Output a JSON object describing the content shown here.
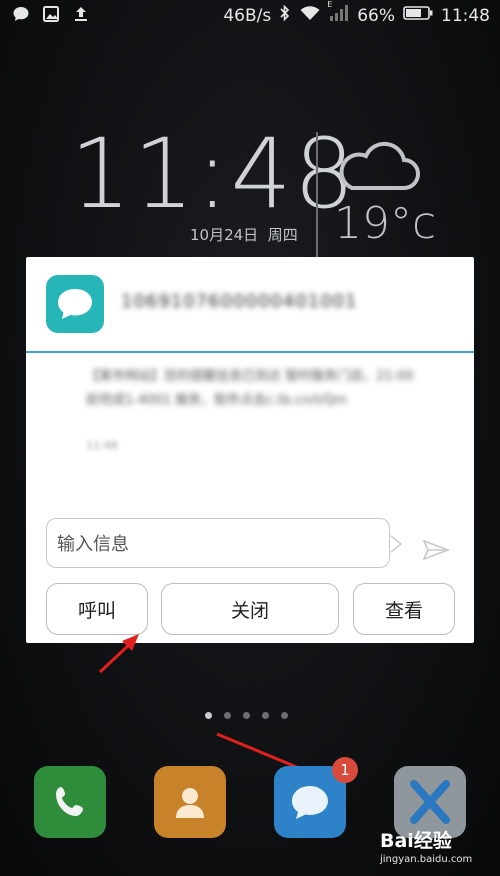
{
  "status_bar": {
    "left_icons": [
      "chat-icon",
      "image-icon",
      "upload-icon"
    ],
    "speed": "46B/s",
    "battery": "66%",
    "time": "11:48",
    "signal_label": "E"
  },
  "clock_widget": {
    "time": "11:48",
    "date": "10月24日",
    "weekday": "周四",
    "temperature": "19°c",
    "weather_icon": "cloudy-icon"
  },
  "notification": {
    "app_icon": "message-bubble-icon",
    "sender": "1069107600000401001",
    "body": "【某市网站】您的提醒信息已到达 暂时服务门店，21:00前完成1-4001 服务，取件点击c.tb.cn/t/Qm",
    "time": "11:48",
    "input_placeholder": "输入信息",
    "send_icon": "send-icon",
    "buttons": {
      "call": "呼叫",
      "close": "关闭",
      "view": "查看"
    }
  },
  "page_indicator": {
    "count": 5,
    "active": 0
  },
  "dock": {
    "apps": [
      {
        "name": "phone",
        "icon": "phone-icon",
        "color": "#2f8c3a"
      },
      {
        "name": "contacts",
        "icon": "contact-icon",
        "color": "#c7822a"
      },
      {
        "name": "messages",
        "icon": "message-bubble-icon",
        "color": "#2e83c8",
        "badge": "1"
      },
      {
        "name": "app-x",
        "icon": "x-icon",
        "color": "#8f969c"
      }
    ]
  },
  "watermark": {
    "brand": "Bai经验",
    "url": "jingyan.baidu.com"
  },
  "colors": {
    "accent_line": "#3aa7d5",
    "arrow": "#e0201c",
    "badge": "#d84a3a",
    "app_teal": "#27b6b8"
  }
}
